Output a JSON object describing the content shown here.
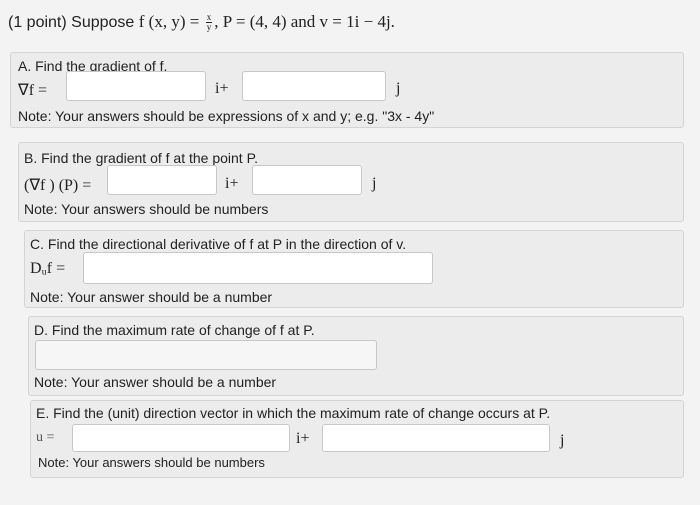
{
  "header": {
    "prefix": "(1 point) Suppose ",
    "func_lhs": "f (x, y) =",
    "frac_num": "x",
    "frac_den": "y",
    "rest": ", P = (4, 4) and v = 1i − 4j."
  },
  "partA": {
    "title": "A. Find the gradient of f.",
    "label": "∇f =",
    "i_label": "i+",
    "j_label": "j",
    "note": "Note: Your answers should be expressions of x and y; e.g. \"3x - 4y\"",
    "input1_value": "",
    "input2_value": ""
  },
  "partB": {
    "title": "B. Find the gradient of f at the point P.",
    "label": "(∇f ) (P) =",
    "i_label": "i+",
    "j_label": "j",
    "note": "Note: Your answers should be numbers",
    "input1_value": "",
    "input2_value": ""
  },
  "partC": {
    "title": "C. Find the directional derivative of f at P in the direction of v.",
    "label": "Dᵤf =",
    "note": "Note: Your answer should be a number",
    "input_value": ""
  },
  "partD": {
    "title": "D. Find the maximum rate of change of f at P.",
    "note": "Note: Your answer should be a number",
    "input_value": ""
  },
  "partE": {
    "title": "E. Find the (unit) direction vector in which the maximum rate of change occurs at P.",
    "label": "u =",
    "i_label": "i+",
    "j_label": "j",
    "note": "Note: Your answers should be numbers",
    "input1_value": "",
    "input2_value": ""
  }
}
